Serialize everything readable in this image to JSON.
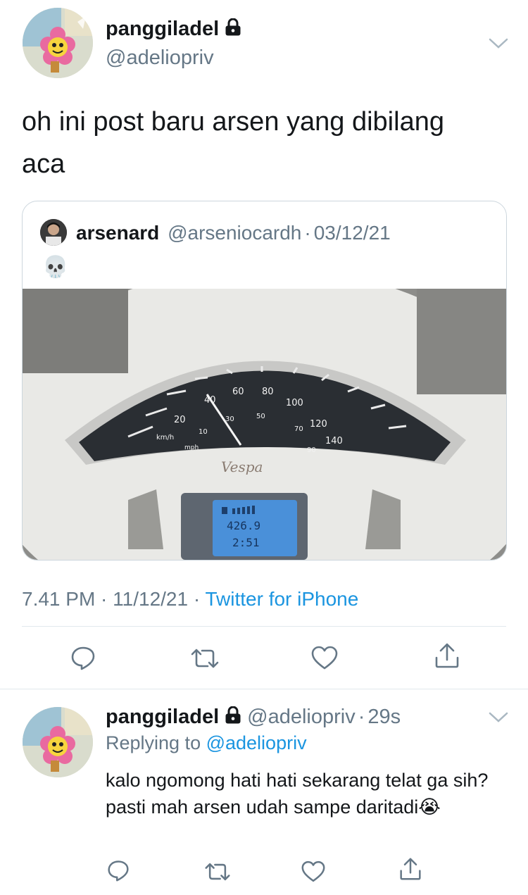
{
  "main_tweet": {
    "display_name": "panggiladel",
    "handle": "@adeliopriv",
    "text": "oh ini post baru arsen yang dibilang aca",
    "timestamp": "7.41 PM · 11/12/21 · ",
    "source": "Twitter for iPhone"
  },
  "quoted_tweet": {
    "display_name": "arsenard",
    "handle": "@arseniocardh",
    "separator": "·",
    "date": "03/12/21",
    "emoji_text": "💀",
    "image_gauge": {
      "speed_ticks_kmh": [
        "20",
        "40",
        "60",
        "80",
        "100",
        "120",
        "140"
      ],
      "speed_ticks_mph": [
        "10",
        "30",
        "50",
        "70",
        "90"
      ],
      "unit_kmh": "km/h",
      "unit_mph": "mph",
      "brand": "Vespa",
      "lcd_odometer": "426.9",
      "lcd_time": "2:51"
    }
  },
  "actions": {
    "reply_icon": "reply-icon",
    "retweet_icon": "retweet-icon",
    "like_icon": "heart-icon",
    "share_icon": "share-icon"
  },
  "reply_tweet": {
    "display_name": "panggiladel",
    "handle": "@adeliopriv",
    "separator": "·",
    "age": "29s",
    "replying_prefix": "Replying to ",
    "replying_to": "@adeliopriv",
    "text": "kalo ngomong hati hati sekarang telat ga sih? pasti mah arsen udah sampe daritadi",
    "emoji": "😭"
  },
  "colors": {
    "accent": "#1b95e0",
    "secondary_text": "#657786",
    "divider": "#e1e8ed"
  }
}
